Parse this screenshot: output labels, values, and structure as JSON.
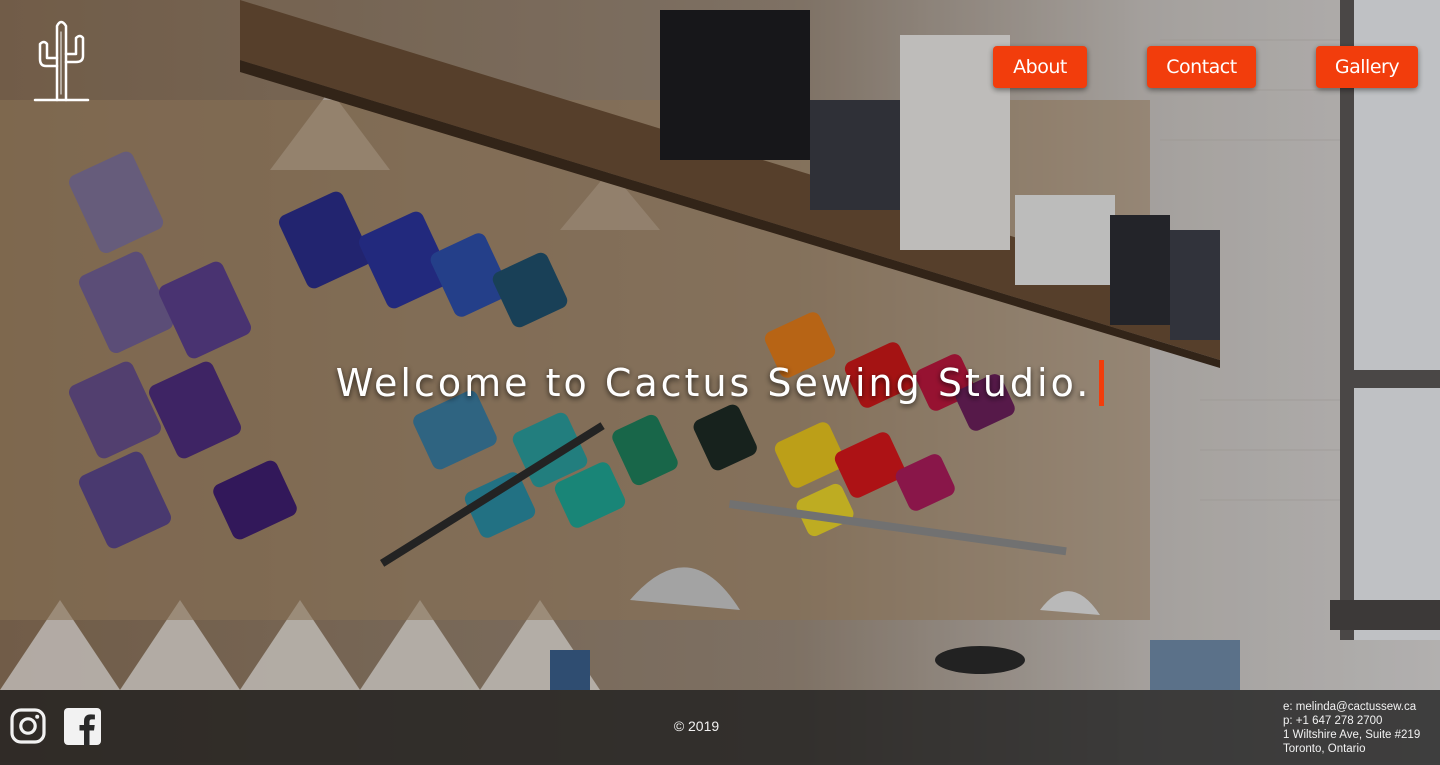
{
  "brand": {
    "logo_icon": "cactus-icon",
    "accent_color": "#f23d0c"
  },
  "nav": {
    "items": [
      {
        "label": "About"
      },
      {
        "label": "Contact"
      },
      {
        "label": "Gallery"
      }
    ]
  },
  "hero": {
    "headline": "Welcome to Cactus Sewing Studio.",
    "background": "sewing-studio-thread-wall-photo"
  },
  "footer": {
    "social": [
      {
        "icon": "instagram-icon"
      },
      {
        "icon": "facebook-icon"
      }
    ],
    "copyright": "© 2019",
    "contact": {
      "email": "e: melinda@cactussew.ca",
      "phone": "p: +1 647 278 2700",
      "address_line1": "1 Wiltshire Ave, Suite #219",
      "address_line2": "Toronto, Ontario"
    }
  }
}
